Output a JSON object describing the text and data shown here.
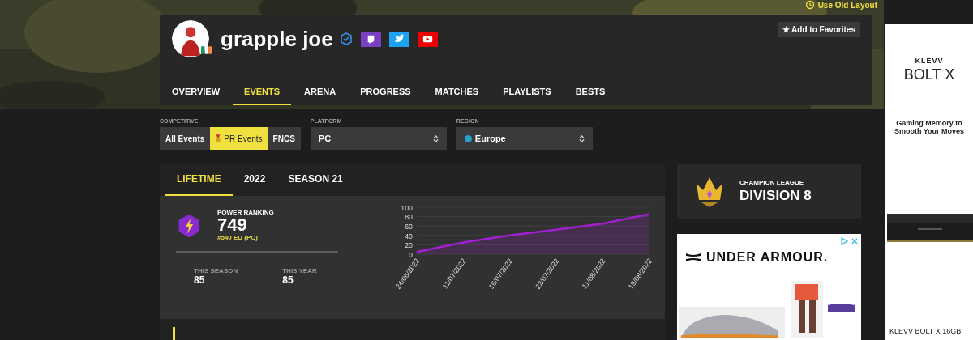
{
  "top_link": "Use Old Layout",
  "profile": {
    "name": "grapple joe",
    "favorite_button": "★ Add to Favorites"
  },
  "nav": [
    {
      "label": "OVERVIEW",
      "selected": false
    },
    {
      "label": "EVENTS",
      "selected": true
    },
    {
      "label": "ARENA",
      "selected": false
    },
    {
      "label": "PROGRESS",
      "selected": false
    },
    {
      "label": "MATCHES",
      "selected": false
    },
    {
      "label": "PLAYLISTS",
      "selected": false
    },
    {
      "label": "BESTS",
      "selected": false
    }
  ],
  "filters": {
    "competitive": {
      "label": "COMPETITIVE",
      "options": [
        {
          "label": "All Events",
          "selected": false
        },
        {
          "label": "PR Events",
          "selected": true
        },
        {
          "label": "FNCS",
          "selected": false
        }
      ]
    },
    "platform": {
      "label": "PLATFORM",
      "value": "PC"
    },
    "region": {
      "label": "REGION",
      "value": "Europe"
    }
  },
  "period_tabs": [
    {
      "label": "LIFETIME",
      "selected": true
    },
    {
      "label": "2022",
      "selected": false
    },
    {
      "label": "SEASON 21",
      "selected": false
    }
  ],
  "power_ranking": {
    "label": "POWER RANKING",
    "value": "749",
    "rank": "#540 EU (PC)",
    "level": 1,
    "stats": [
      {
        "label": "THIS SEASON",
        "value": "85"
      },
      {
        "label": "THIS YEAR",
        "value": "85"
      }
    ],
    "chart_data": {
      "type": "area",
      "categories": [
        "24/06/2022",
        "11/07/2022",
        "16/07/2022",
        "22/07/2022",
        "11/08/2022",
        "19/08/2022"
      ],
      "ylim": [
        0,
        100
      ],
      "grid": true,
      "yticks": [
        0,
        20,
        40,
        60,
        80,
        100
      ],
      "series": [
        {
          "color": "#a020d0",
          "values": [
            5,
            25,
            40,
            52,
            65,
            85
          ]
        }
      ]
    }
  },
  "league": {
    "label": "CHAMPION LEAGUE",
    "division": "DIVISION 8"
  },
  "ad_under_armour": {
    "brand": "UNDER ARMOUR."
  },
  "ad_klevv": {
    "brand": "KLEVV",
    "product": "BOLT X",
    "tagline": [
      "Gaming Memory to",
      "Smooth Your Moves"
    ],
    "caption": "KLEVV BOLT X 16GB"
  }
}
